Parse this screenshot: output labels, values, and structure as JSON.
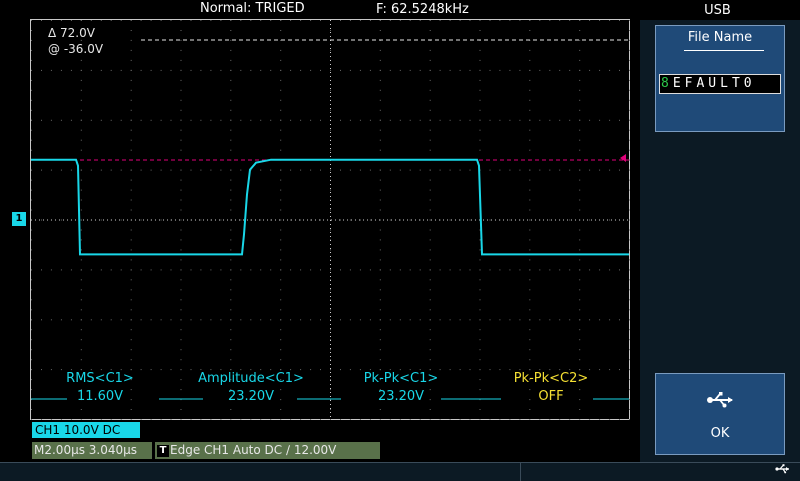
{
  "header": {
    "trigger_status": "Normal:  TRIGED",
    "frequency": "F:  62.5248kHz",
    "menu_title": "USB",
    "trigger_marker": "T"
  },
  "cursor": {
    "delta": "Δ  72.0V",
    "at": "@  -36.0V"
  },
  "channel_marker": "1",
  "measurements": [
    {
      "label": "RMS<C1>",
      "value": "11.60V",
      "color": "#19d7e8"
    },
    {
      "label": "Amplitude<C1>",
      "value": "23.20V",
      "color": "#19d7e8"
    },
    {
      "label": "Pk-Pk<C1>",
      "value": "23.20V",
      "color": "#19d7e8"
    },
    {
      "label": "Pk-Pk<C2>",
      "value": "OFF",
      "color": "#f5e033"
    }
  ],
  "channel_info": "CH1  10.0V  DC",
  "timebase_info": "M2.00μs  3.040μs",
  "trigger_info": {
    "icon": "T",
    "text": "Edge  CH1  Auto  DC  ∕  12.00V"
  },
  "file_panel": {
    "title": "File Name",
    "cursor_char": "8",
    "value": "EFAULT0"
  },
  "ok_panel": {
    "label": "OK",
    "icon": "usb-icon"
  },
  "colors": {
    "waveform": "#19d7e8",
    "trigger_level": "#e0007a",
    "panel": "#1f4a78",
    "channel2": "#f5e033"
  },
  "waveform": {
    "type": "square",
    "frequency": "62.5248kHz",
    "high_level_div": 1.2,
    "low_level_div": -0.7,
    "volts_per_div": "10.0V"
  }
}
